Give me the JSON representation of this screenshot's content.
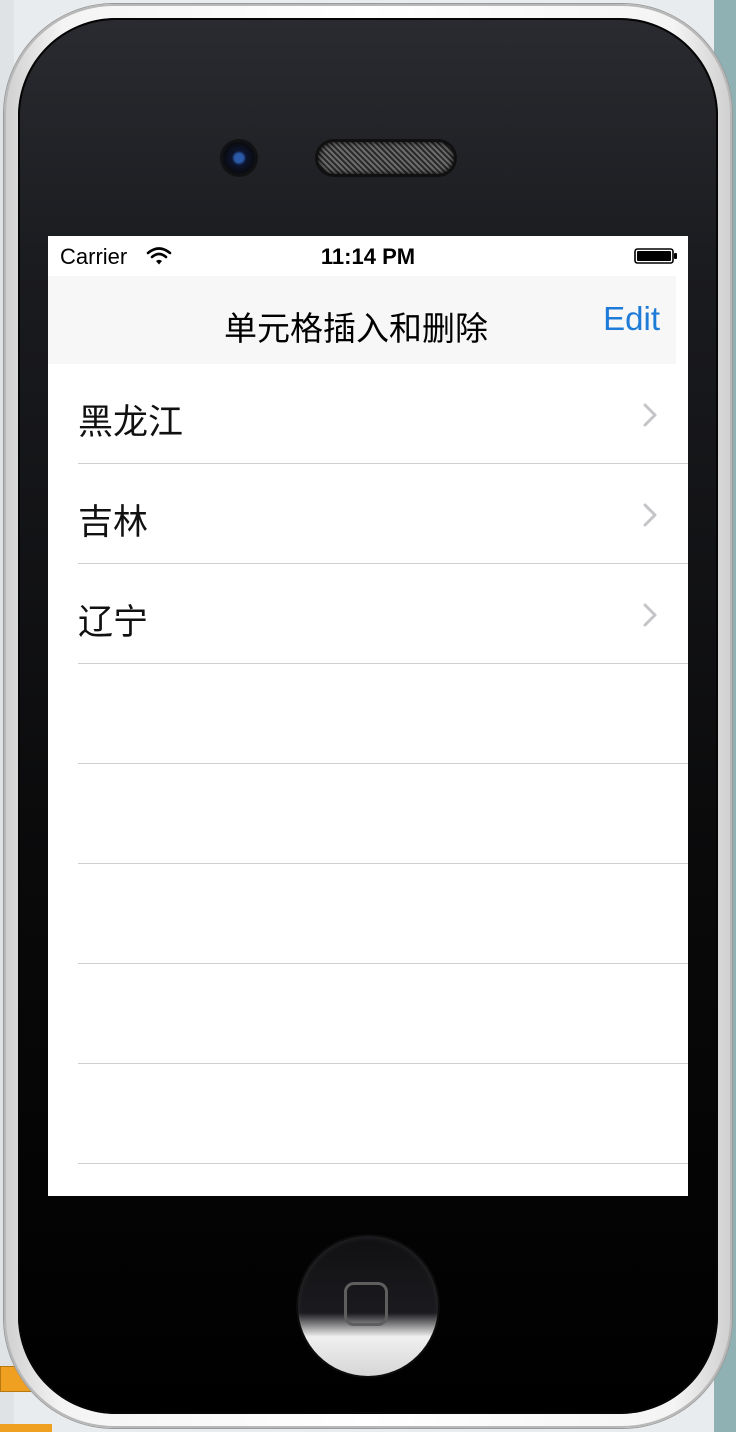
{
  "status_bar": {
    "carrier": "Carrier",
    "time": "11:14 PM"
  },
  "nav_bar": {
    "title": "单元格插入和删除",
    "edit_label": "Edit"
  },
  "table": {
    "rows": [
      {
        "label": "黑龙江"
      },
      {
        "label": "吉林"
      },
      {
        "label": "辽宁"
      }
    ],
    "empty_rows": 5
  },
  "colors": {
    "accent": "#1f7bd8",
    "separator": "#cfcfd3",
    "nav_background": "#f7f7f7"
  },
  "icons": [
    "wifi-icon",
    "battery-icon",
    "chevron-right-icon",
    "home-button-icon"
  ]
}
